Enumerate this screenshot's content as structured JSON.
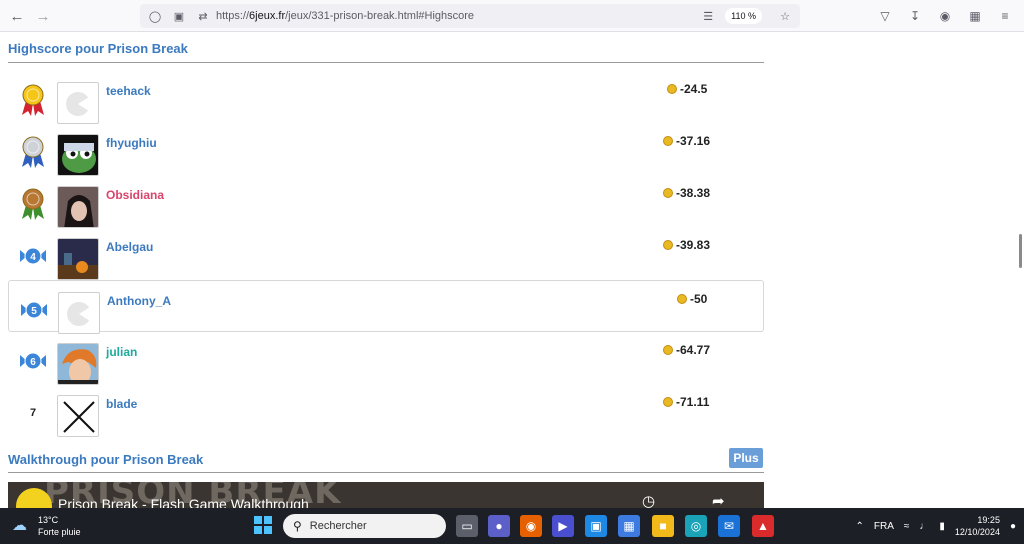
{
  "browser": {
    "url_prefix": "https://",
    "url_domain": "6jeux.fr",
    "url_path": "/jeux/331-prison-break.html#Highscore",
    "zoom": "110 %"
  },
  "highscore": {
    "title": "Highscore pour Prison Break",
    "rows": [
      {
        "rank": "",
        "medal": "gold",
        "name": "teehack",
        "score": "-24.5",
        "name_color": "blue"
      },
      {
        "rank": "",
        "medal": "silver",
        "name": "fhyughiu",
        "score": "-37.16",
        "name_color": "blue"
      },
      {
        "rank": "",
        "medal": "bronze",
        "name": "Obsidiana",
        "score": "-38.38",
        "name_color": "pink"
      },
      {
        "rank": "4",
        "medal": "ribbon",
        "name": "Abelgau",
        "score": "-39.83",
        "name_color": "blue"
      },
      {
        "rank": "5",
        "medal": "ribbon",
        "name": "Anthony_A",
        "score": "-50",
        "name_color": "blue"
      },
      {
        "rank": "6",
        "medal": "ribbon",
        "name": "julian",
        "score": "-64.77",
        "name_color": "teal"
      },
      {
        "rank": "7",
        "medal": "none",
        "name": "blade",
        "score": "-71.11",
        "name_color": "blue"
      }
    ]
  },
  "walkthrough": {
    "title": "Walkthrough pour Prison Break",
    "plus_label": "Plus",
    "video_title": "Prison Break - Flash Game Walkthrough",
    "video_bg": "PRISON BREAK"
  },
  "taskbar": {
    "temperature": "13°C",
    "weather": "Forte pluie",
    "search_placeholder": "Rechercher",
    "language": "FRA",
    "time": "19:25",
    "date": "12/10/2024"
  },
  "colors": {
    "accent": "#3b7abf",
    "pink": "#d9456b",
    "teal": "#1fa99a",
    "taskbar": "#1c1f26"
  }
}
